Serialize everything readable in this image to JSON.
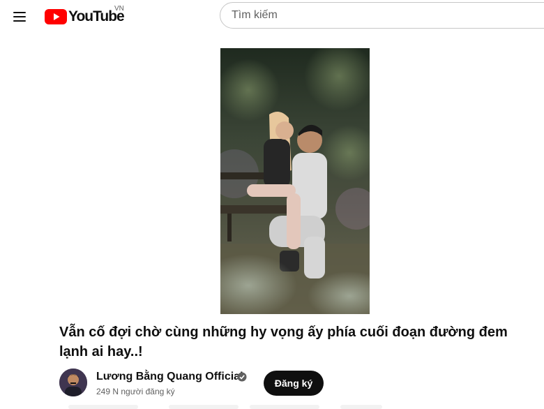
{
  "header": {
    "logo_text": "YouTube",
    "country_code": "VN",
    "search_placeholder": "Tìm kiếm"
  },
  "video": {
    "title": "Vẫn cố đợi chờ cùng những hy vọng ấy phía cuối đoạn đường đem lạnh ai hay..!"
  },
  "channel": {
    "name": "Lương Bằng Quang Official",
    "subscribers": "249 N người đăng ký",
    "subscribe_label": "Đăng ký",
    "verified": true
  },
  "colors": {
    "brand_red": "#ff0000",
    "text_primary": "#0f0f0f",
    "text_secondary": "#606060",
    "subscribe_bg": "#0f0f0f"
  },
  "icons": [
    "menu-icon",
    "youtube-logo-icon",
    "verified-check-icon"
  ]
}
